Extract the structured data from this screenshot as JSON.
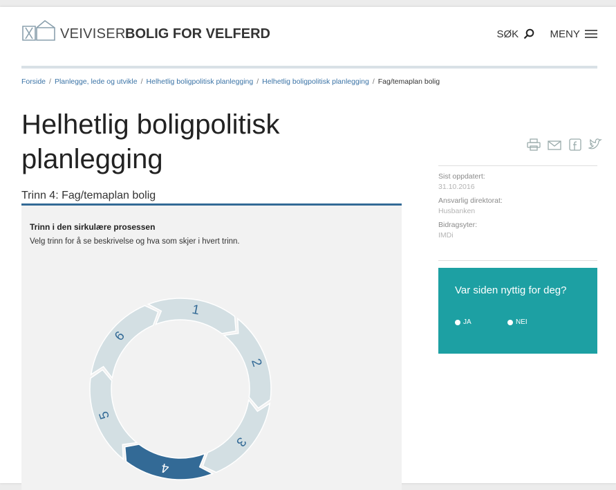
{
  "header": {
    "brand_prefix": "VEIVISER",
    "brand_main": "BOLIG FOR VELFERD",
    "search_label": "SØK",
    "menu_label": "MENY"
  },
  "breadcrumb": [
    "Forside",
    "Planlegge, lede og utvikle",
    "Helhetlig boligpolitisk planlegging",
    "Helhetlig boligpolitisk planlegging",
    "Fag/temaplan bolig"
  ],
  "page": {
    "title_line1": "Helhetlig boligpolitisk",
    "title_line2": "planlegging",
    "subtitle": "Trinn 4: Fag/temaplan bolig"
  },
  "process": {
    "heading": "Trinn i den sirkulære prosessen",
    "description": "Velg trinn for å se beskrivelse og hva som skjer i hvert trinn.",
    "steps": [
      "1",
      "2",
      "3",
      "4",
      "5",
      "6"
    ],
    "active_step": "4",
    "colors": {
      "inactive": "#d3dfe3",
      "active": "#336a96",
      "text": "#336a96",
      "active_text": "#ffffff"
    }
  },
  "sidebar": {
    "share_icons": [
      "print-icon",
      "mail-icon",
      "facebook-icon",
      "twitter-icon"
    ],
    "updated_label": "Sist oppdatert:",
    "updated_value": "31.10.2016",
    "directorate_label": "Ansvarlig direktorat:",
    "directorate_value": "Husbanken",
    "contributor_label": "Bidragsyter:",
    "contributor_value": "IMDi"
  },
  "feedback": {
    "question": "Var siden nyttig for deg?",
    "yes_label": "JA",
    "no_label": "NEI",
    "bg_color": "#1da0a3"
  }
}
